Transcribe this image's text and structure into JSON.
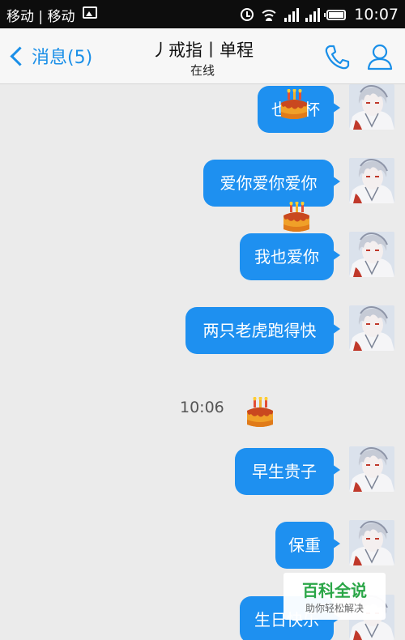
{
  "status_bar": {
    "carrier": "移动 | 移动",
    "time": "10:07"
  },
  "nav": {
    "back_label": "消息(5)",
    "title": "丿戒指丨单程",
    "subtitle": "在线"
  },
  "messages": [
    {
      "text": "也干杯"
    },
    {
      "text": "爱你爱你爱你"
    },
    {
      "text": "我也爱你"
    },
    {
      "text": "两只老虎跑得快"
    },
    {
      "text": "早生贵子"
    },
    {
      "text": "保重"
    },
    {
      "text": "生日快乐"
    }
  ],
  "timestamp": "10:06",
  "watermark": {
    "title": "百科全说",
    "subtitle": "助你轻松解决"
  },
  "colors": {
    "bubble": "#1e90f0",
    "accent": "#1a8fe8",
    "watermark_green": "#2aa647"
  },
  "icons": {
    "back": "chevron-left-icon",
    "phone": "phone-icon",
    "contact": "contact-icon",
    "cake": "birthday-cake-icon"
  }
}
